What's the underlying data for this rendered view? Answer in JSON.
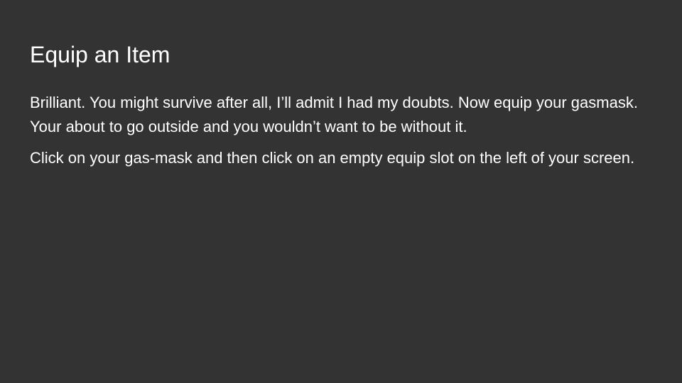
{
  "slide": {
    "title": "Equip an Item",
    "paragraphs": [
      "Brilliant. You might survive after all, I’ll admit I had my doubts. Now equip your gasmask. Your about to go outside and you wouldn’t want to be without it.",
      "Click on your gas-mask and then click on an empty equip slot on the left of your screen."
    ]
  },
  "colors": {
    "background": "#333333",
    "text": "#ffffff"
  }
}
